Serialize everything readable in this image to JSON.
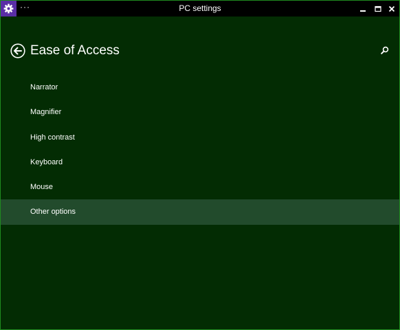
{
  "window": {
    "title": "PC settings",
    "menu_label": "···"
  },
  "icons": {
    "app": "gear-icon",
    "back": "back-arrow-circle-icon",
    "search": "search-icon",
    "minimize": "minimize-icon",
    "maximize": "maximize-icon",
    "close": "close-icon"
  },
  "header": {
    "title": "Ease of Access"
  },
  "nav": {
    "items": [
      {
        "label": "Narrator"
      },
      {
        "label": "Magnifier"
      },
      {
        "label": "High contrast"
      },
      {
        "label": "Keyboard"
      },
      {
        "label": "Mouse"
      },
      {
        "label": "Other options"
      }
    ],
    "selected_label": "Other options"
  },
  "colors": {
    "background": "#032c03",
    "titlebar": "#000000",
    "app_icon_bg": "#5a2ea6",
    "selected_item": "#224b2c",
    "border": "#1f8a1f",
    "text": "#ffffff"
  }
}
